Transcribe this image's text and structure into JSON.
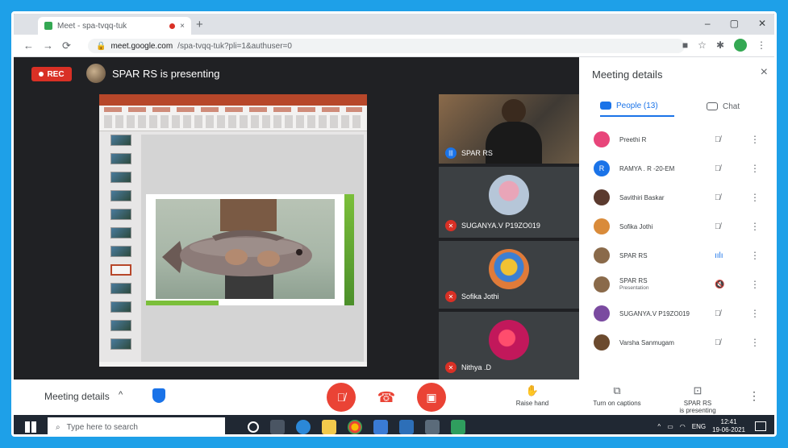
{
  "browser": {
    "tab_title": "Meet - spa-tvqq-tuk",
    "tab_close": "×",
    "new_tab": "+",
    "url_host": "meet.google.com",
    "url_path": "/spa-tvqq-tuk?pli=1&authuser=0",
    "window_controls": [
      "–",
      "▢",
      "✕"
    ],
    "nav": {
      "back": "←",
      "forward": "→",
      "reload": "⟳"
    }
  },
  "meet": {
    "rec_label": "REC",
    "presenting_text": "SPAR RS is presenting",
    "tiles": [
      {
        "name": "SPAR RS",
        "state": "speaking"
      },
      {
        "name": "SUGANYA.V P19ZO019",
        "state": "muted"
      },
      {
        "name": "Sofika Jothi",
        "state": "muted"
      },
      {
        "name": "Nithya .D",
        "state": "muted"
      }
    ]
  },
  "panel": {
    "title": "Meeting details",
    "close": "×",
    "tab_people": "People (13)",
    "tab_chat": "Chat",
    "participants": [
      {
        "name": "Preethi R",
        "sub": "",
        "mic": "muted",
        "color": "#e8457a"
      },
      {
        "name": "RAMYA . R -20-EM",
        "sub": "",
        "mic": "muted",
        "color": "#1a73e8",
        "initial": "R"
      },
      {
        "name": "Savithiri Baskar",
        "sub": "",
        "mic": "muted",
        "color": "#5b3a2e"
      },
      {
        "name": "Sofika Jothi",
        "sub": "",
        "mic": "muted",
        "color": "#d98b3a"
      },
      {
        "name": "SPAR RS",
        "sub": "",
        "mic": "active",
        "color": "#8a6a4a"
      },
      {
        "name": "SPAR RS",
        "sub": "Presentation",
        "mic": "off",
        "color": "#8a6a4a"
      },
      {
        "name": "SUGANYA.V P19ZO019",
        "sub": "",
        "mic": "muted",
        "color": "#7a4aa0"
      },
      {
        "name": "Varsha Sanmugam",
        "sub": "",
        "mic": "muted",
        "color": "#6b4a2e"
      }
    ]
  },
  "bottombar": {
    "meeting_details": "Meeting details",
    "chevron": "^",
    "raise_hand": "Raise hand",
    "captions": "Turn on captions",
    "presenting_line1": "SPAR RS",
    "presenting_line2": "is presenting",
    "more": "⋮"
  },
  "taskbar": {
    "search_placeholder": "Type here to search",
    "lang": "ENG",
    "time": "12:41",
    "date": "19-06-2021"
  }
}
